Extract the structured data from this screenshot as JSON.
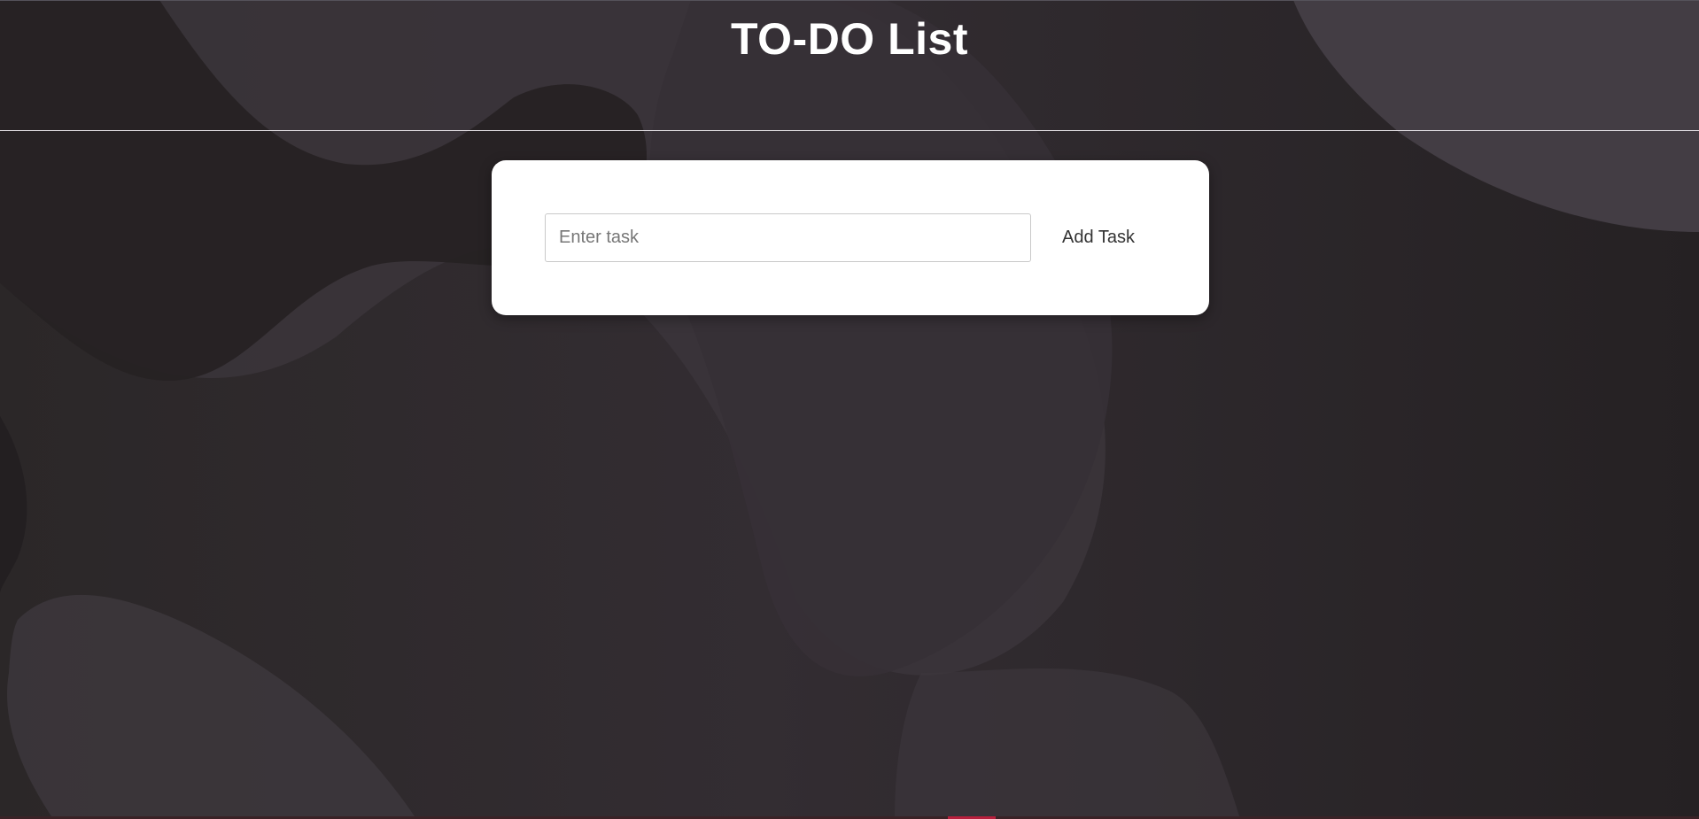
{
  "app": {
    "title": "TO-DO List"
  },
  "task_form": {
    "input_value": "",
    "input_placeholder": "Enter task",
    "add_button_label": "Add Task"
  },
  "colors": {
    "background": "#2c2829",
    "card": "#ffffff",
    "title_text": "#ffffff",
    "header_rule": "#e9e6ea",
    "bottom_accent": "#b81f3d"
  }
}
